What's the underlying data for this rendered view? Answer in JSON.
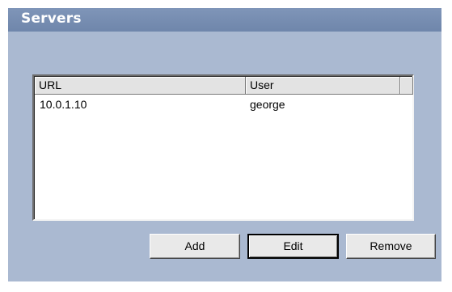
{
  "panel": {
    "title": "Servers"
  },
  "servers_list": {
    "columns": [
      "URL",
      "User",
      ""
    ],
    "rows": [
      {
        "url": "10.0.1.10",
        "user": "george"
      }
    ]
  },
  "buttons": {
    "add": "Add",
    "edit": "Edit",
    "remove": "Remove"
  },
  "colors": {
    "header_bar": "#7489ae",
    "panel_body": "#aab9d1",
    "button_face": "#e9e9e9"
  }
}
